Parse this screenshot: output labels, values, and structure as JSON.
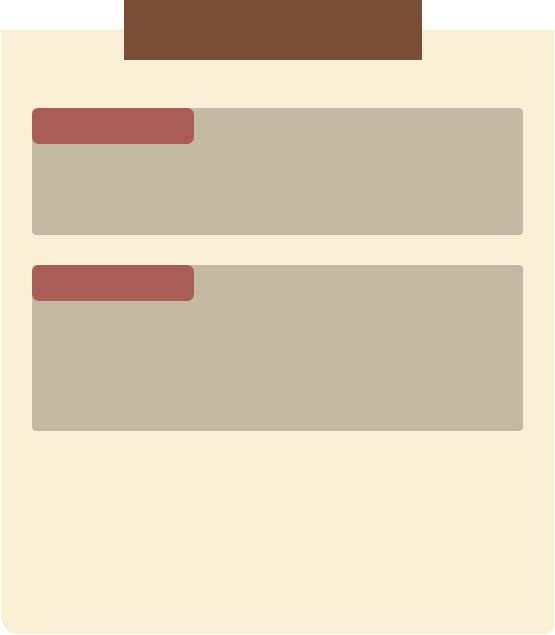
{
  "header": {
    "title": ""
  },
  "cards": [
    {
      "label": "",
      "body": ""
    },
    {
      "label": "",
      "body": ""
    }
  ],
  "colors": {
    "header_tab": "#7a4d36",
    "paper": "#f8efd4",
    "card": "#c4baa3",
    "card_label": "#aa5d55"
  }
}
